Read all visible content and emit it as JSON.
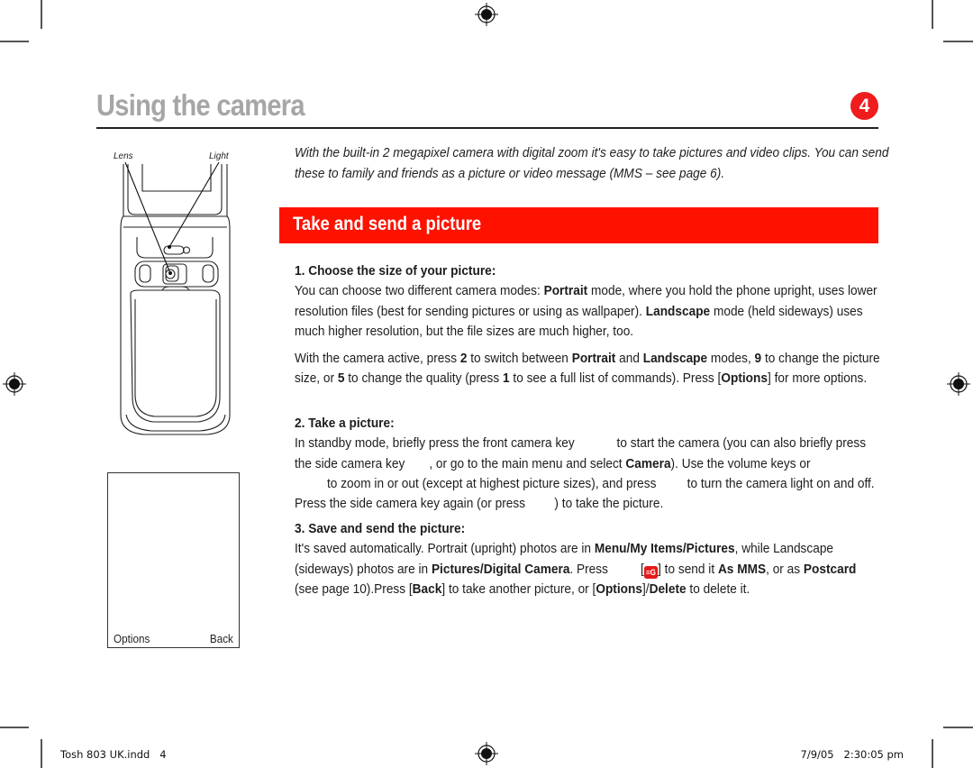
{
  "page": {
    "title": "Using the camera",
    "chapter_number": "4",
    "intro": "With the built-in 2 megapixel camera with digital zoom it's easy to take pictures and video clips. You can send these to family and friends as a picture or video message (MMS – see page 6).",
    "section_title": "Take and send a picture"
  },
  "illustration": {
    "lens_label": "Lens",
    "light_label": "Light",
    "screen_softkey_left": "Options",
    "screen_softkey_right": "Back"
  },
  "steps": [
    {
      "heading": "1. Choose the size of your picture:",
      "paragraphs": [
        {
          "t1": "You can choose two different camera modes: ",
          "b1": "Portrait",
          "t2": " mode, where you hold the phone upright, uses lower resolution files (best for sending pictures or using as wallpaper). ",
          "b2": "Landscape",
          "t3": " mode (held sideways) uses much higher resolution, but the file sizes are much higher, too."
        },
        {
          "t1": "With the camera active, press ",
          "b1": "2",
          "t2": " to switch between ",
          "b2": "Portrait",
          "t3": " and ",
          "b3": "Landscape",
          "t4": " modes, ",
          "b4": "9",
          "t5": " to change the picture size, or ",
          "b5": "5",
          "t6": " to change the quality (press ",
          "b6": "1",
          "t7": " to see a full list of commands). Press [",
          "b7": "Options",
          "t8": "] for more options."
        }
      ]
    },
    {
      "heading": "2. Take a picture:",
      "t1": "In standby mode, briefly press the front camera key",
      "t2": "to start the camera (you can also briefly press the side camera key",
      "t3": ", or go to the main menu and select ",
      "b1": "Camera",
      "t4": "). Use the volume keys or",
      "t5": "to zoom in or out (except at highest picture sizes), and press",
      "t6": "to turn the camera light on and off. Press the side camera key again (or press",
      "t7": ") to take the picture."
    },
    {
      "heading": "3. Save and send the picture:",
      "t1": "It's saved automatically. Portrait (upright) photos are in ",
      "b1": "Menu",
      "s1": "/",
      "b2": "My Items",
      "s2": "/",
      "b3": "Pictures",
      "t2": ", while Landscape (sideways) photos are in ",
      "b4": "Pictures",
      "s3": "/",
      "b5": "Digital Camera",
      "t3": ". Press",
      "t4": "[",
      "key_icon": "send-key-icon",
      "t5": "] to send it ",
      "b6": "As MMS",
      "t6": ", or as ",
      "b7": "Postcard",
      "t7": " (see page 10).Press [",
      "b8": "Back",
      "t8": "] to take another picture, or [",
      "b9": "Options",
      "t9": "]/",
      "b10": "Delete",
      "t10": " to delete it."
    }
  ],
  "footer": {
    "left": "Tosh 803 UK.indd   4",
    "right": "7/9/05   2:30:05 pm"
  },
  "colors": {
    "accent_red": "#ff1100",
    "badge_red": "#ee1c1c",
    "title_gray": "#a6a6a6"
  }
}
